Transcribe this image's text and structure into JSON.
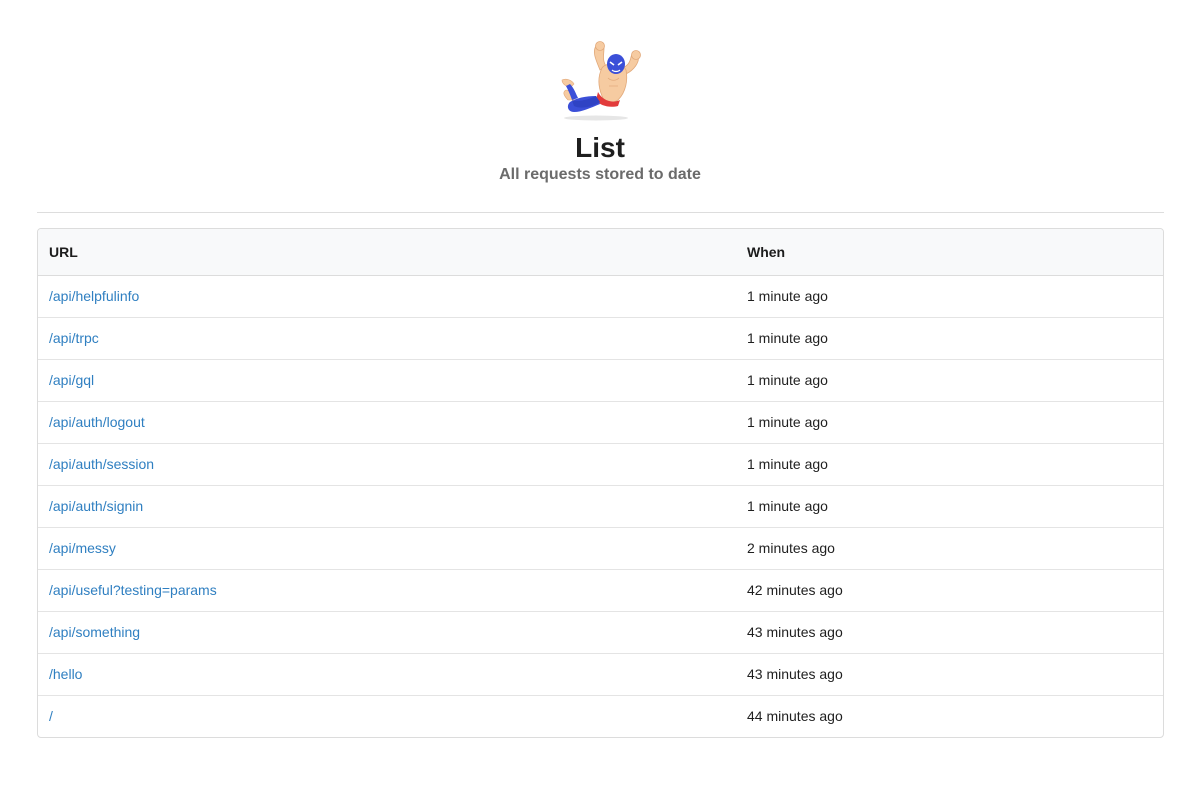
{
  "header": {
    "title": "List",
    "subtitle": "All requests stored to date"
  },
  "table": {
    "columns": {
      "url": "URL",
      "when": "When"
    },
    "rows": [
      {
        "url": "/api/helpfulinfo",
        "when": "1 minute ago"
      },
      {
        "url": "/api/trpc",
        "when": "1 minute ago"
      },
      {
        "url": "/api/gql",
        "when": "1 minute ago"
      },
      {
        "url": "/api/auth/logout",
        "when": "1 minute ago"
      },
      {
        "url": "/api/auth/session",
        "when": "1 minute ago"
      },
      {
        "url": "/api/auth/signin",
        "when": "1 minute ago"
      },
      {
        "url": "/api/messy",
        "when": "2 minutes ago"
      },
      {
        "url": "/api/useful?testing=params",
        "when": "42 minutes ago"
      },
      {
        "url": "/api/something",
        "when": "43 minutes ago"
      },
      {
        "url": "/hello",
        "when": "43 minutes ago"
      },
      {
        "url": "/",
        "when": "44 minutes ago"
      }
    ]
  },
  "colors": {
    "link": "#2f7fc1",
    "header_bg": "#f8f9fa",
    "border": "#dcdcdc",
    "subtitle": "#6b6b6b"
  },
  "icons": {
    "logo": "luchador-wrestler-mascot"
  }
}
